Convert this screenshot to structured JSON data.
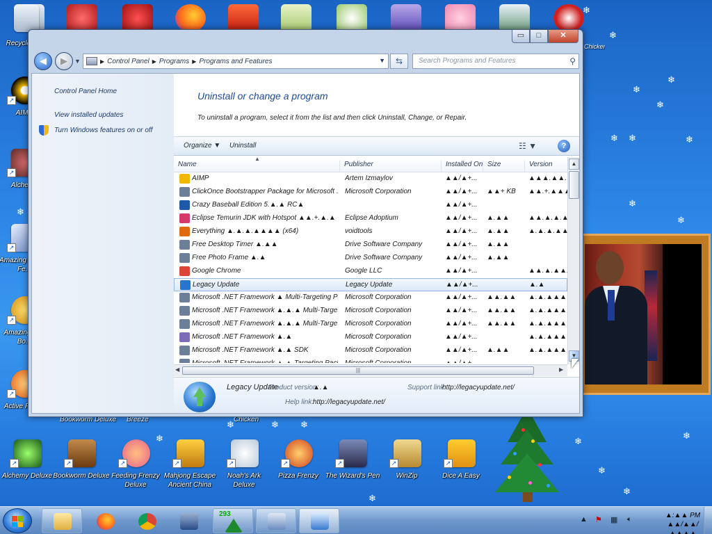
{
  "desktop": {
    "icons_left": [
      {
        "label": "Recycle Bin"
      },
      {
        "label": "AIMP"
      },
      {
        "label": "Alchemy"
      },
      {
        "label": "Amazing Animal Fe..."
      },
      {
        "label": "Amazing The Bo..."
      },
      {
        "label": "Active Player"
      }
    ],
    "icons_bottom": [
      {
        "label": "Alchemy Deluxe"
      },
      {
        "label": "Bookworm Deluxe"
      },
      {
        "label": "Feeding Frenzy Deluxe"
      },
      {
        "label": "Mahjong Escape Ancient China"
      },
      {
        "label": "Noah's Ark Deluxe"
      },
      {
        "label": "Pizza Frenzy"
      },
      {
        "label": "The Wizard's Pen"
      },
      {
        "label": "WinZip"
      },
      {
        "label": "Dice A Easy"
      }
    ],
    "row_labels_behind_window": [
      "Bookworm Deluxe",
      "Breeze",
      "Chicken"
    ],
    "top_right_label": "Chicken Invaders"
  },
  "window": {
    "caption": {
      "minimize": "▭",
      "maximize": "□",
      "close": "✕"
    },
    "breadcrumb": [
      "Control Panel",
      "Programs",
      "Programs and Features"
    ],
    "search_placeholder": "Search Programs and Features",
    "left_tasks": [
      "Control Panel Home",
      "View installed updates",
      "Turn Windows features on or off"
    ],
    "title": "Uninstall or change a program",
    "description": "To uninstall a program, select it from the list and then click Uninstall, Change, or Repair.",
    "toolbar": {
      "organize": "Organize",
      "uninstall": "Uninstall",
      "help": "?"
    },
    "columns": [
      "Name",
      "Publisher",
      "Installed On",
      "Size",
      "Version"
    ],
    "programs": [
      {
        "name": "AIMP",
        "publisher": "Artem Izmaylov",
        "installed": "▲▲/▲+...",
        "size": "",
        "version": "▲▲▲.▲▲.▲▲",
        "icon_color": "#f0b800"
      },
      {
        "name": "ClickOnce Bootstrapper Package for Microsoft .NET...",
        "publisher": "Microsoft Corporation",
        "installed": "▲▲/▲+...",
        "size": "▲▲+ KB",
        "version": "▲▲.+.▲▲▲.▲▲",
        "icon_color": "#6c7e98"
      },
      {
        "name": "Crazy Baseball Edition 5.▲.▲ RC▲",
        "publisher": "",
        "installed": "▲▲/▲+...",
        "size": "",
        "version": "",
        "icon_color": "#1e5aa8"
      },
      {
        "name": "Eclipse Temurin JDK with Hotspot ▲▲.+.▲.▲ (x64)",
        "publisher": "Eclipse Adoptium",
        "installed": "▲▲/▲+...",
        "size": "▲.▲▲",
        "version": "▲▲.▲.▲.▲",
        "icon_color": "#d43a6a"
      },
      {
        "name": "Everything ▲.▲.▲.▲▲▲▲ (x64)",
        "publisher": "voidtools",
        "installed": "▲▲/▲+...",
        "size": "▲.▲▲",
        "version": "▲.▲.▲.▲▲▲▲",
        "icon_color": "#e06a10"
      },
      {
        "name": "Free Desktop Timer ▲.▲▲",
        "publisher": "Drive Software Company",
        "installed": "▲▲/▲+...",
        "size": "▲.▲▲",
        "version": "",
        "icon_color": "#6c7e98"
      },
      {
        "name": "Free Photo Frame ▲.▲",
        "publisher": "Drive Software Company",
        "installed": "▲▲/▲+...",
        "size": "▲.▲▲",
        "version": "",
        "icon_color": "#6c7e98"
      },
      {
        "name": "Google Chrome",
        "publisher": "Google LLC",
        "installed": "▲▲/▲+...",
        "size": "",
        "version": "▲▲.▲.▲▲.▲▲",
        "icon_color": "#db4437"
      },
      {
        "name": "Legacy Update",
        "publisher": "Legacy Update",
        "installed": "▲▲/▲+...",
        "size": "",
        "version": "▲.▲",
        "icon_color": "#2676d0",
        "selected": true
      },
      {
        "name": "Microsoft .NET Framework ▲ Multi-Targeting Pack",
        "publisher": "Microsoft Corporation",
        "installed": "▲▲/▲+...",
        "size": "▲▲.▲▲",
        "version": "▲.▲.▲▲▲▲▲",
        "icon_color": "#6c7e98"
      },
      {
        "name": "Microsoft .NET Framework ▲.▲.▲ Multi-Targeting ...",
        "publisher": "Microsoft Corporation",
        "installed": "▲▲/▲+...",
        "size": "▲▲.▲▲",
        "version": "▲.▲.▲▲▲▲▲",
        "icon_color": "#6c7e98"
      },
      {
        "name": "Microsoft .NET Framework ▲.▲.▲ Multi-Targeting ...",
        "publisher": "Microsoft Corporation",
        "installed": "▲▲/▲+...",
        "size": "▲▲.▲▲",
        "version": "▲.▲.▲▲▲▲▲",
        "icon_color": "#6c7e98"
      },
      {
        "name": "Microsoft .NET Framework ▲.▲",
        "publisher": "Microsoft Corporation",
        "installed": "▲▲/▲+...",
        "size": "",
        "version": "▲.▲.▲▲▲▲▲",
        "icon_color": "#7c6cb8"
      },
      {
        "name": "Microsoft .NET Framework ▲.▲ SDK",
        "publisher": "Microsoft Corporation",
        "installed": "▲▲/▲+...",
        "size": "▲.▲▲",
        "version": "▲.▲.▲▲▲▲▲",
        "icon_color": "#6c7e98"
      },
      {
        "name": "Microsoft .NET Framework ▲.▲ Targeting Pack",
        "publisher": "Microsoft Corporation",
        "installed": "▲▲/▲+...",
        "size": "",
        "version": "",
        "icon_color": "#6c7e98"
      }
    ],
    "details": {
      "name": "Legacy Update",
      "product_version_label": "Product version:",
      "product_version": "▲.▲",
      "support_link_label": "Support link:",
      "support_link": "http://legacyupdate.net/",
      "help_link_label": "Help link:",
      "help_link": "http://legacyupdate.net/"
    }
  },
  "taskbar": {
    "score": "293",
    "clock_time": "▲:▲▲ PM",
    "clock_date": "▲▲/▲▲/▲▲▲▲"
  }
}
